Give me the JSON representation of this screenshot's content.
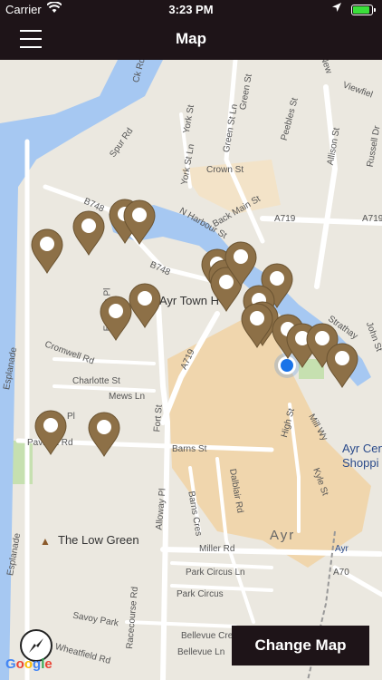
{
  "status_bar": {
    "carrier": "Carrier",
    "time": "3:23 PM"
  },
  "nav": {
    "title": "Map"
  },
  "map": {
    "street_labels": [
      "Spur Rd",
      "York St Ln",
      "York St",
      "Green St Ln",
      "Green St",
      "Crown St",
      "Peebles St",
      "Allison St",
      "Russell Dr",
      "N Harbour St",
      "Back Main St",
      "A719",
      "A719",
      "B748",
      "B748",
      "Ayr Town H",
      "Eglinton Pl",
      "Cromwell Rd",
      "Charlotte St",
      "Mews Ln",
      "Fort St",
      "A719",
      "High St",
      "Mill Wy",
      "Kyle St",
      "Ayr Cen",
      "Shoppi",
      "Esplanade",
      "Pl",
      "Pavilion Rd",
      "Barns St",
      "Dalblair Rd",
      "Alloway Pl",
      "Barns Cres",
      "Ayr",
      "Miller Rd",
      "Ayr",
      "A70",
      "Park Circus Ln",
      "Park Circus",
      "Savoy Park",
      "Bellevue Cres",
      "Racecourse Rd",
      "Bellevue Ln",
      "Wheatfield Rd",
      "Esplanade",
      "Viewfiel",
      "John St",
      "Strathay",
      "Ck Rd",
      "New"
    ],
    "poi": "The Low Green",
    "attribution": "Google",
    "brand_color": "#1e1418",
    "pin_color": "#8d7047",
    "water_color": "#a6c8f2"
  },
  "change_map_label": "Change Map"
}
